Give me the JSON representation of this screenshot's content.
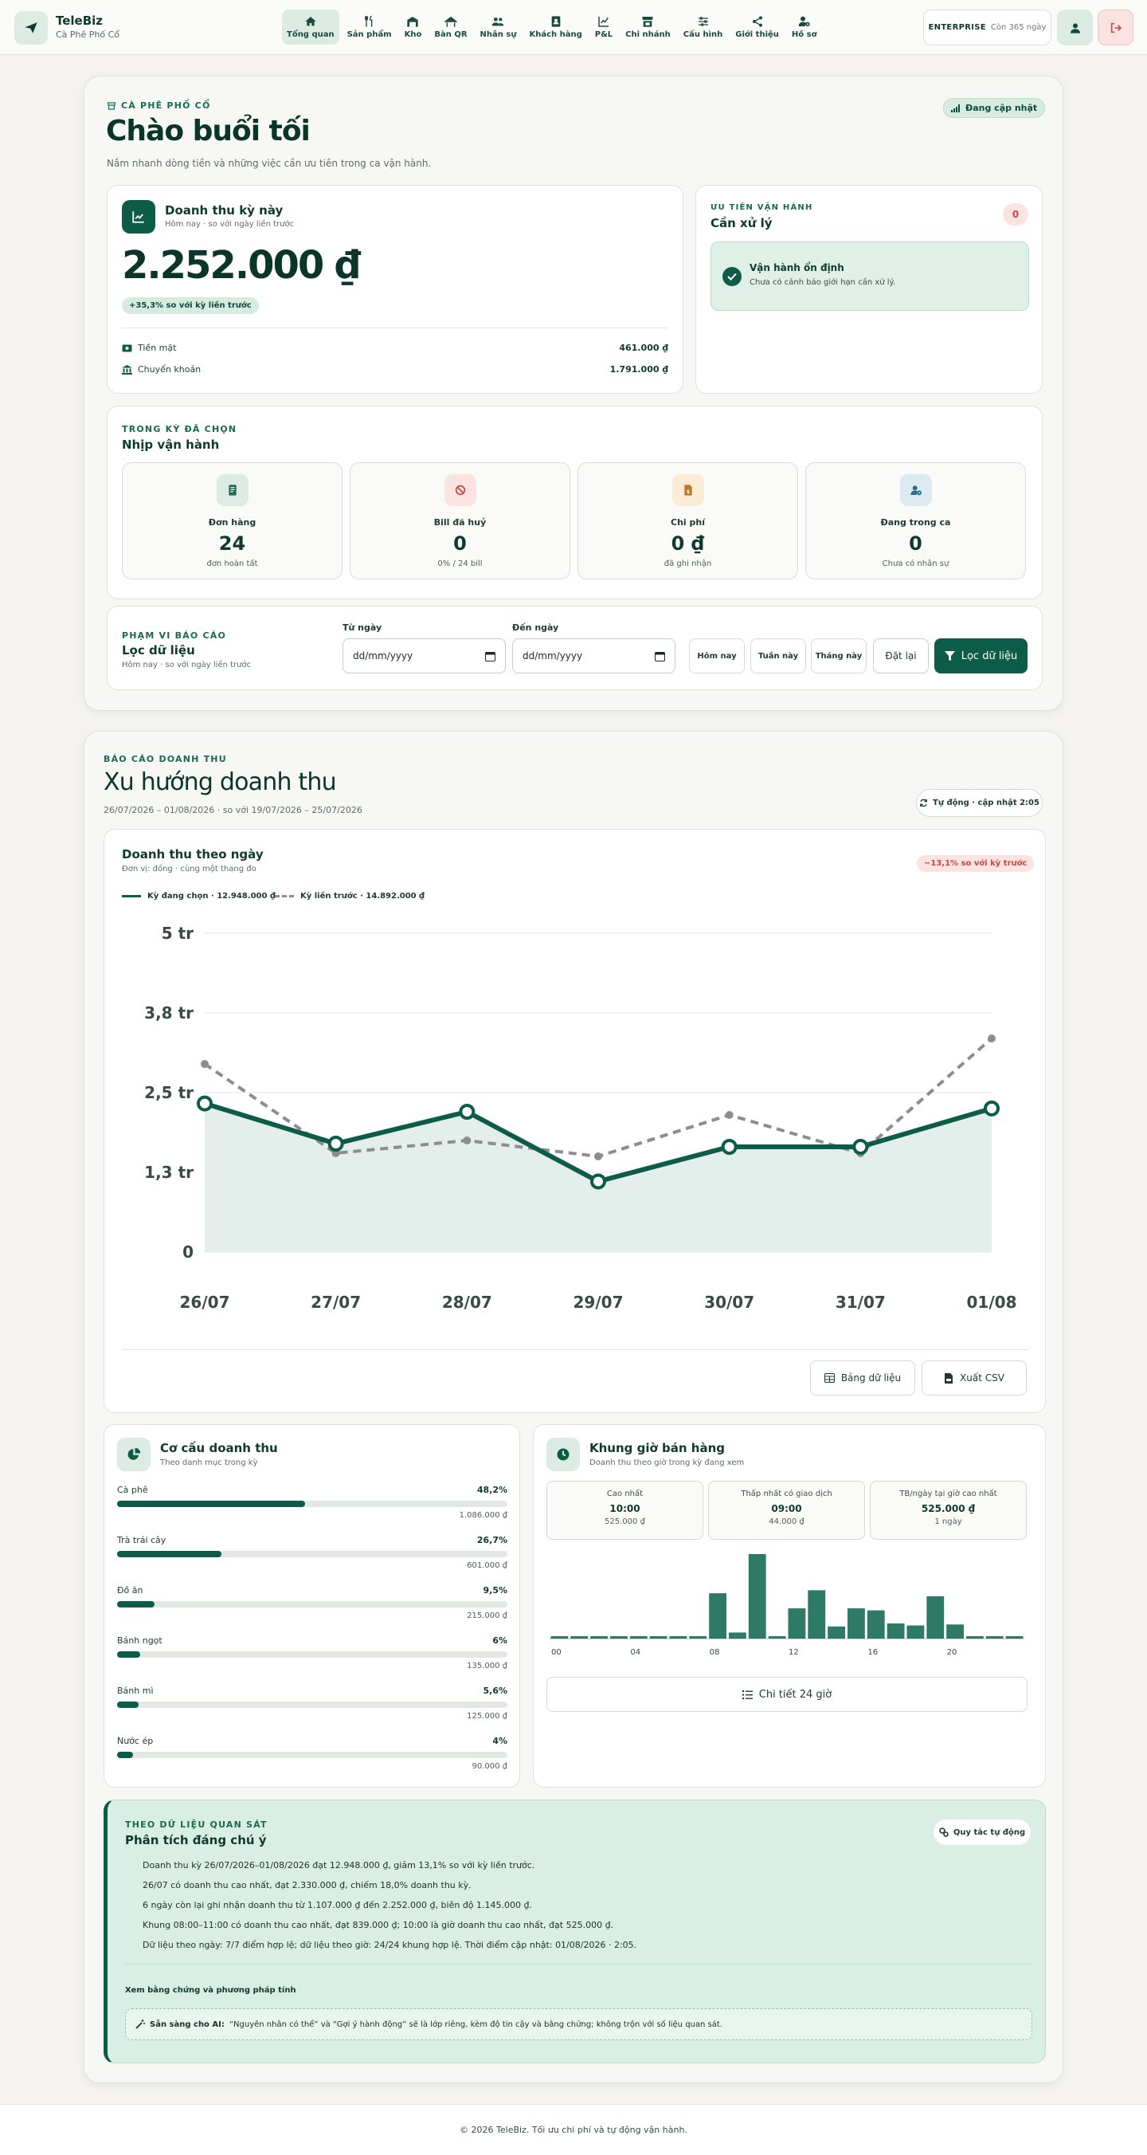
{
  "brand": {
    "name": "TeleBiz",
    "subtitle": "Cà Phê Phố Cổ"
  },
  "nav": [
    {
      "label": "Tổng quan",
      "icon": "home-icon",
      "active": true
    },
    {
      "label": "Sản phẩm",
      "icon": "utensils-icon"
    },
    {
      "label": "Kho",
      "icon": "warehouse-icon"
    },
    {
      "label": "Bàn QR",
      "icon": "table-icon"
    },
    {
      "label": "Nhân sự",
      "icon": "users-icon"
    },
    {
      "label": "Khách hàng",
      "icon": "address-book-icon"
    },
    {
      "label": "P&L",
      "icon": "chart-line-icon"
    },
    {
      "label": "Chi nhánh",
      "icon": "store-icon"
    },
    {
      "label": "Cấu hình",
      "icon": "sliders-icon"
    },
    {
      "label": "Giới thiệu",
      "icon": "share-icon"
    },
    {
      "label": "Hồ sơ",
      "icon": "user-gear-icon"
    }
  ],
  "plan": {
    "name": "ENTERPRISE",
    "remaining": "Còn 365 ngày"
  },
  "hero": {
    "store": "CÀ PHÊ PHỐ CỔ",
    "live_badge": "Đang cập nhật",
    "greeting": "Chào buổi tối",
    "description": "Nắm nhanh dòng tiền và những việc cần ưu tiên trong ca vận hành."
  },
  "revenue": {
    "title": "Doanh thu kỳ này",
    "subtitle": "Hôm nay · so với ngày liền trước",
    "amount": "2.252.000 ₫",
    "delta": "+35,3% so với kỳ liền trước",
    "cash_label": "Tiền mặt",
    "cash_value": "461.000 ₫",
    "transfer_label": "Chuyển khoản",
    "transfer_value": "1.791.000 ₫"
  },
  "priority": {
    "kicker": "ƯU TIÊN VẬN HÀNH",
    "title": "Cần xử lý",
    "count": "0",
    "status_title": "Vận hành ổn định",
    "status_sub": "Chưa có cảnh báo giới hạn cần xử lý."
  },
  "pulse": {
    "kicker": "TRONG KỲ ĐÃ CHỌN",
    "title": "Nhịp vận hành",
    "stats": [
      {
        "label": "Đơn hàng",
        "value": "24",
        "sub": "đơn hoàn tất",
        "icon": "receipt-icon",
        "color": "#dcebe4",
        "fg": "#1d6a52"
      },
      {
        "label": "Bill đã huỷ",
        "value": "0",
        "sub": "0% / 24 bill",
        "icon": "ban-icon",
        "color": "#fbe3e1",
        "fg": "#c24a44"
      },
      {
        "label": "Chi phí",
        "value": "0 ₫",
        "sub": "đã ghi nhận",
        "icon": "invoice-dollar-icon",
        "color": "#fbedd5",
        "fg": "#b7792a"
      },
      {
        "label": "Đang trong ca",
        "value": "0",
        "sub": "Chưa có nhân sự",
        "icon": "user-clock-icon",
        "color": "#dcebf1",
        "fg": "#2a6e8a"
      }
    ]
  },
  "filter": {
    "kicker": "PHẠM VI BÁO CÁO",
    "title": "Lọc dữ liệu",
    "subtitle": "Hôm nay · so với ngày liền trước",
    "from_label": "Từ ngày",
    "to_label": "Đến ngày",
    "date_placeholder": "dd/mm/yyyy",
    "quick": [
      "Hôm nay",
      "Tuần này",
      "Tháng này"
    ],
    "reset": "Đặt lại",
    "apply": "Lọc dữ liệu"
  },
  "report": {
    "kicker": "BÁO CÁO DOANH THU",
    "title": "Xu hướng doanh thu",
    "range": "26/07/2026 – 01/08/2026 · so với 19/07/2026 – 25/07/2026",
    "auto": "Tự động · cập nhật 2:05"
  },
  "daily_chart": {
    "title": "Doanh thu theo ngày",
    "subtitle": "Đơn vị: đồng · cùng một thang đo",
    "delta": "−13,1% so với kỳ trước",
    "legend_current": "Kỳ đang chọn · 12.948.000 ₫",
    "legend_previous": "Kỳ liền trước · 14.892.000 ₫",
    "btn_table": "Bảng dữ liệu",
    "btn_csv": "Xuất CSV"
  },
  "chart_data": [
    {
      "type": "line",
      "categories": [
        "26/07",
        "27/07",
        "28/07",
        "29/07",
        "30/07",
        "31/07",
        "01/08"
      ],
      "y_ticks": [
        "0",
        "1,3 tr",
        "2,5 tr",
        "3,8 tr",
        "5 tr"
      ],
      "ylim": [
        0,
        5000000
      ],
      "series": [
        {
          "name": "Kỳ đang chọn · 12.948.000 ₫",
          "values": [
            2330000,
            1700000,
            2200000,
            1107000,
            1650000,
            1650000,
            2252000
          ],
          "color": "#0d5c47"
        },
        {
          "name": "Kỳ liền trước · 14.892.000 ₫",
          "values": [
            2950000,
            1550000,
            1750000,
            1500000,
            2150000,
            1550000,
            3350000
          ],
          "color": "#8a8f8c"
        }
      ],
      "grid": true
    },
    {
      "type": "bar",
      "categories": [
        "00",
        "01",
        "02",
        "03",
        "04",
        "05",
        "06",
        "07",
        "08",
        "09",
        "10",
        "11",
        "12",
        "13",
        "14",
        "15",
        "16",
        "17",
        "18",
        "19",
        "20",
        "21",
        "22",
        "23"
      ],
      "x_ticks": [
        "00",
        "04",
        "08",
        "12",
        "16",
        "20"
      ],
      "values": [
        0,
        0,
        0,
        0,
        0,
        0,
        0,
        0,
        450000,
        60000,
        839000,
        0,
        300000,
        480000,
        120000,
        300000,
        280000,
        150000,
        130000,
        420000,
        140000,
        0,
        0,
        0
      ]
    }
  ],
  "mix": {
    "title": "Cơ cấu doanh thu",
    "subtitle": "Theo danh mục trong kỳ",
    "items": [
      {
        "name": "Cà phê",
        "pct": "48,2%",
        "share": 0.482,
        "amount": "1.086.000 ₫"
      },
      {
        "name": "Trà trái cây",
        "pct": "26,7%",
        "share": 0.267,
        "amount": "601.000 ₫"
      },
      {
        "name": "Đồ ăn",
        "pct": "9,5%",
        "share": 0.095,
        "amount": "215.000 ₫"
      },
      {
        "name": "Bánh ngọt",
        "pct": "6%",
        "share": 0.06,
        "amount": "135.000 ₫"
      },
      {
        "name": "Bánh mì",
        "pct": "5,6%",
        "share": 0.056,
        "amount": "125.000 ₫"
      },
      {
        "name": "Nước ép",
        "pct": "4%",
        "share": 0.04,
        "amount": "90.000 ₫"
      }
    ]
  },
  "hours": {
    "title": "Khung giờ bán hàng",
    "subtitle": "Doanh thu theo giờ trong kỳ đang xem",
    "boxes": [
      {
        "label": "Cao nhất",
        "value": "10:00",
        "sub": "525.000 ₫"
      },
      {
        "label": "Thấp nhất có giao dịch",
        "value": "09:00",
        "sub": "44.000 ₫"
      },
      {
        "label": "TB/ngày tại giờ cao nhất",
        "value": "525.000 ₫",
        "sub": "1 ngày"
      }
    ],
    "detail_btn": "Chi tiết 24 giờ"
  },
  "insights": {
    "kicker": "THEO DỮ LIỆU QUAN SÁT",
    "title": "Phân tích đáng chú ý",
    "rules_btn": "Quy tắc tự động",
    "lines": [
      "Doanh thu kỳ 26/07/2026–01/08/2026 đạt 12.948.000 ₫, giảm 13,1% so với kỳ liền trước.",
      "26/07 có doanh thu cao nhất, đạt 2.330.000 ₫, chiếm 18,0% doanh thu kỳ.",
      "6 ngày còn lại ghi nhận doanh thu từ 1.107.000 ₫ đến 2.252.000 ₫, biên độ 1.145.000 ₫.",
      "Khung 08:00–11:00 có doanh thu cao nhất, đạt 839.000 ₫; 10:00 là giờ doanh thu cao nhất, đạt 525.000 ₫.",
      "Dữ liệu theo ngày: 7/7 điểm hợp lệ; dữ liệu theo giờ: 24/24 khung hợp lệ. Thời điểm cập nhật: 01/08/2026 · 2:05."
    ],
    "evidence": "Xem bằng chứng và phương pháp tính",
    "ai_label": "Sẵn sàng cho AI:",
    "ai_text": "“Nguyên nhân có thể” và “Gợi ý hành động” sẽ là lớp riêng, kèm độ tin cậy và bằng chứng; không trộn với số liệu quan sát."
  },
  "footer": "© 2026 TeleBiz. Tối ưu chi phí và tự động vận hành."
}
